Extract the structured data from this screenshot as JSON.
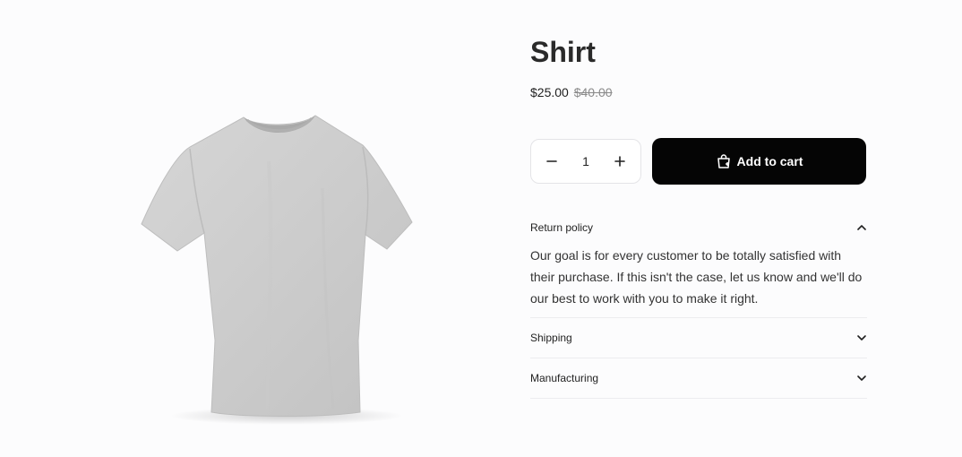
{
  "product": {
    "title": "Shirt",
    "price_current": "$25.00",
    "price_old": "$40.00",
    "image_icon": "tshirt-image"
  },
  "quantity": {
    "value": "1",
    "decrement_icon": "minus-icon",
    "increment_icon": "plus-icon"
  },
  "cart_button": {
    "label": "Add to cart",
    "icon": "shopping-bag-icon",
    "background": "#050505"
  },
  "accordion": [
    {
      "label": "Return policy",
      "expanded": true,
      "body": "Our goal is for every customer to be totally satisfied with their purchase. If this isn't the case, let us know and we'll do our best to work with you to make it right.",
      "icon": "chevron-up-icon"
    },
    {
      "label": "Shipping",
      "expanded": false,
      "icon": "chevron-down-icon"
    },
    {
      "label": "Manufacturing",
      "expanded": false,
      "icon": "chevron-down-icon"
    }
  ]
}
